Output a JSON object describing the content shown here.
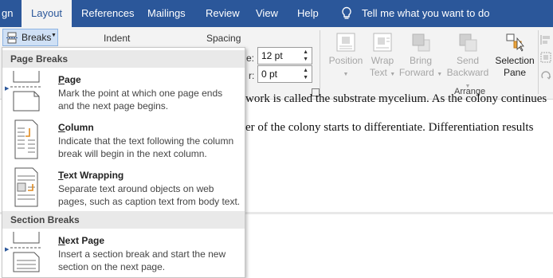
{
  "tabs": [
    {
      "label": "gn",
      "active": false
    },
    {
      "label": "Layout",
      "active": true
    },
    {
      "label": "References",
      "active": false
    },
    {
      "label": "Mailings",
      "active": false
    },
    {
      "label": "Review",
      "active": false
    },
    {
      "label": "View",
      "active": false
    },
    {
      "label": "Help",
      "active": false
    }
  ],
  "tell_me": "Tell me what you want to do",
  "ribbon": {
    "breaks_label": "Breaks",
    "indent_label": "Indent",
    "spacing_label": "Spacing",
    "spacing_before_label": "e:",
    "spacing_before_value": "12 pt",
    "spacing_after_label": "r:",
    "spacing_after_value": "0 pt",
    "arrange": {
      "position": "Position",
      "wrap_1": "Wrap",
      "wrap_2": "Text",
      "bring_1": "Bring",
      "bring_2": "Forward",
      "send_1": "Send",
      "send_2": "Backward",
      "selection_1": "Selection",
      "selection_2": "Pane",
      "group_label": "Arrange"
    }
  },
  "document": {
    "line1": "work is called the substrate mycelium. As the colony continues",
    "line2": "er of the colony starts to differentiate. Differentiation results"
  },
  "menu": {
    "page_breaks_header": "Page Breaks",
    "section_breaks_header": "Section Breaks",
    "items": [
      {
        "title_key": "P",
        "title_rest": "age",
        "desc1": "Mark the point at which one page ends",
        "desc2": "and the next page begins.",
        "icon": "page-break-icon"
      },
      {
        "title_key": "C",
        "title_rest": "olumn",
        "desc1": "Indicate that the text following the column",
        "desc2": "break will begin in the next column.",
        "icon": "column-break-icon"
      },
      {
        "title_key": "T",
        "title_rest": "ext Wrapping",
        "desc1": "Separate text around objects on web",
        "desc2": "pages, such as caption text from body text.",
        "icon": "text-wrapping-break-icon"
      },
      {
        "title_key": "N",
        "title_rest": "ext Page",
        "desc1": "Insert a section break and start the new",
        "desc2": "section on the next page.",
        "icon": "next-page-break-icon"
      }
    ]
  },
  "colors": {
    "ribbon_blue": "#2b579a",
    "ribbon_bg": "#f3f3f3",
    "menu_header_bg": "#e9e9e9"
  }
}
